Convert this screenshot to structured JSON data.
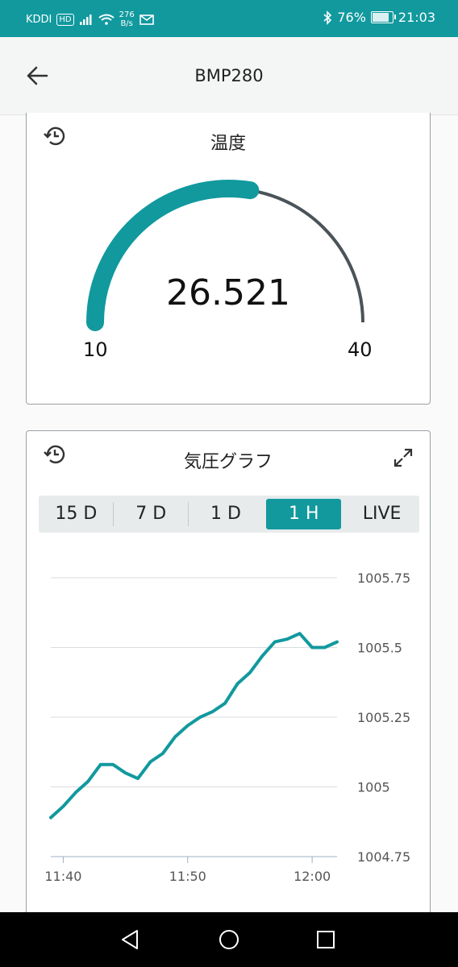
{
  "status_bar": {
    "carrier": "KDDI",
    "hd_badge": "HD",
    "net_speed_value": "276",
    "net_speed_unit": "B/s",
    "battery": "76%",
    "time": "21:03"
  },
  "app_bar": {
    "title": "BMP280"
  },
  "temperature_card": {
    "title": "温度",
    "value": "26.521",
    "min": "10",
    "max": "40",
    "value_num": 26.521,
    "min_num": 10,
    "max_num": 40,
    "accent_color": "#11999e",
    "track_color": "#4a5358"
  },
  "pressure_card": {
    "title": "気圧グラフ",
    "tabs": [
      "15 D",
      "7 D",
      "1 D",
      "1 H",
      "LIVE"
    ],
    "active_tab": "1 H",
    "chart_data": {
      "type": "line",
      "x": [
        "11:39",
        "11:40",
        "11:41",
        "11:42",
        "11:43",
        "11:44",
        "11:45",
        "11:46",
        "11:47",
        "11:48",
        "11:49",
        "11:50",
        "11:51",
        "11:52",
        "11:53",
        "11:54",
        "11:55",
        "11:56",
        "11:57",
        "11:58",
        "11:59",
        "12:00",
        "12:01",
        "12:02"
      ],
      "series": [
        {
          "values": [
            1004.89,
            1004.93,
            1004.98,
            1005.02,
            1005.08,
            1005.08,
            1005.05,
            1005.03,
            1005.09,
            1005.12,
            1005.18,
            1005.22,
            1005.25,
            1005.27,
            1005.3,
            1005.37,
            1005.41,
            1005.47,
            1005.52,
            1005.53,
            1005.55,
            1005.5,
            1005.5,
            1005.52
          ]
        }
      ],
      "x_ticks": [
        "11:40",
        "11:50",
        "12:00"
      ],
      "y_ticks": [
        "1005.75",
        "1005.5",
        "1005.25",
        "1005",
        "1004.75"
      ],
      "ylim": [
        1004.75,
        1005.75
      ],
      "grid": true,
      "line_color": "#11999e"
    }
  }
}
